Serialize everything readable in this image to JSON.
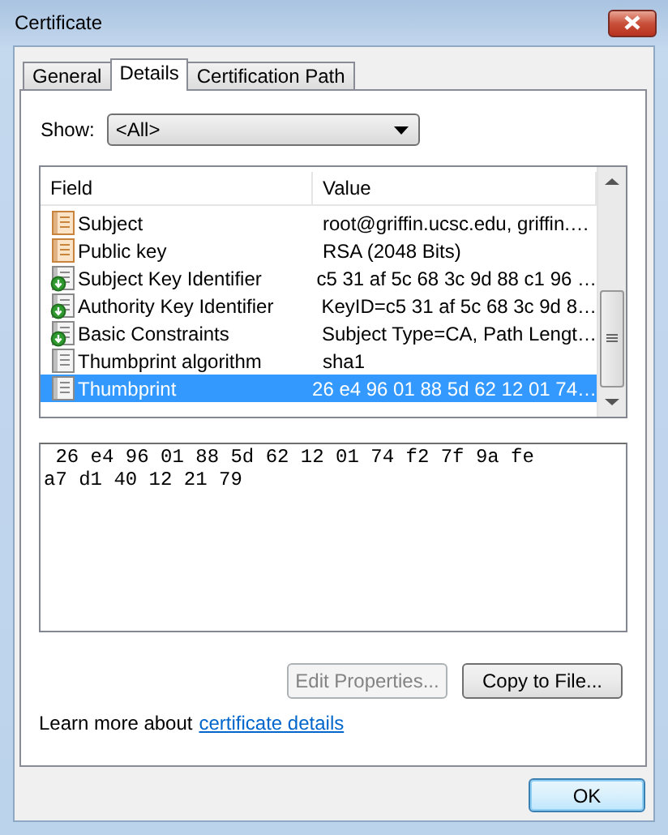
{
  "window": {
    "title": "Certificate"
  },
  "tabs": [
    {
      "label": "General",
      "selected": false
    },
    {
      "label": "Details",
      "selected": true
    },
    {
      "label": "Certification Path",
      "selected": false
    }
  ],
  "show": {
    "label": "Show:",
    "value": "<All>"
  },
  "table": {
    "columns": [
      "Field",
      "Value"
    ],
    "rows": [
      {
        "kind": "field",
        "field": "Subject",
        "value": "root@griffin.ucsc.edu, griffin.…",
        "selected": false
      },
      {
        "kind": "field",
        "field": "Public key",
        "value": "RSA (2048 Bits)",
        "selected": false
      },
      {
        "kind": "extension",
        "field": "Subject Key Identifier",
        "value": "c5 31 af 5c 68 3c 9d 88 c1 96 …",
        "selected": false
      },
      {
        "kind": "extension",
        "field": "Authority Key Identifier",
        "value": "KeyID=c5 31 af 5c 68 3c 9d 8…",
        "selected": false
      },
      {
        "kind": "extension",
        "field": "Basic Constraints",
        "value": "Subject Type=CA, Path Lengt…",
        "selected": false
      },
      {
        "kind": "property",
        "field": "Thumbprint algorithm",
        "value": "sha1",
        "selected": false
      },
      {
        "kind": "property",
        "field": "Thumbprint",
        "value": "26 e4 96 01 88 5d 62 12 01 74…",
        "selected": true
      }
    ]
  },
  "detail_lines": [
    " 26 e4 96 01 88 5d 62 12 01 74 f2 7f 9a fe",
    "a7 d1 40 12 21 79"
  ],
  "buttons": [
    {
      "label": "Edit Properties...",
      "disabled": true
    },
    {
      "label": "Copy to File...",
      "disabled": false
    }
  ],
  "learn_more": {
    "text": "Learn more about",
    "link": "certificate details"
  },
  "ok_button": "OK"
}
